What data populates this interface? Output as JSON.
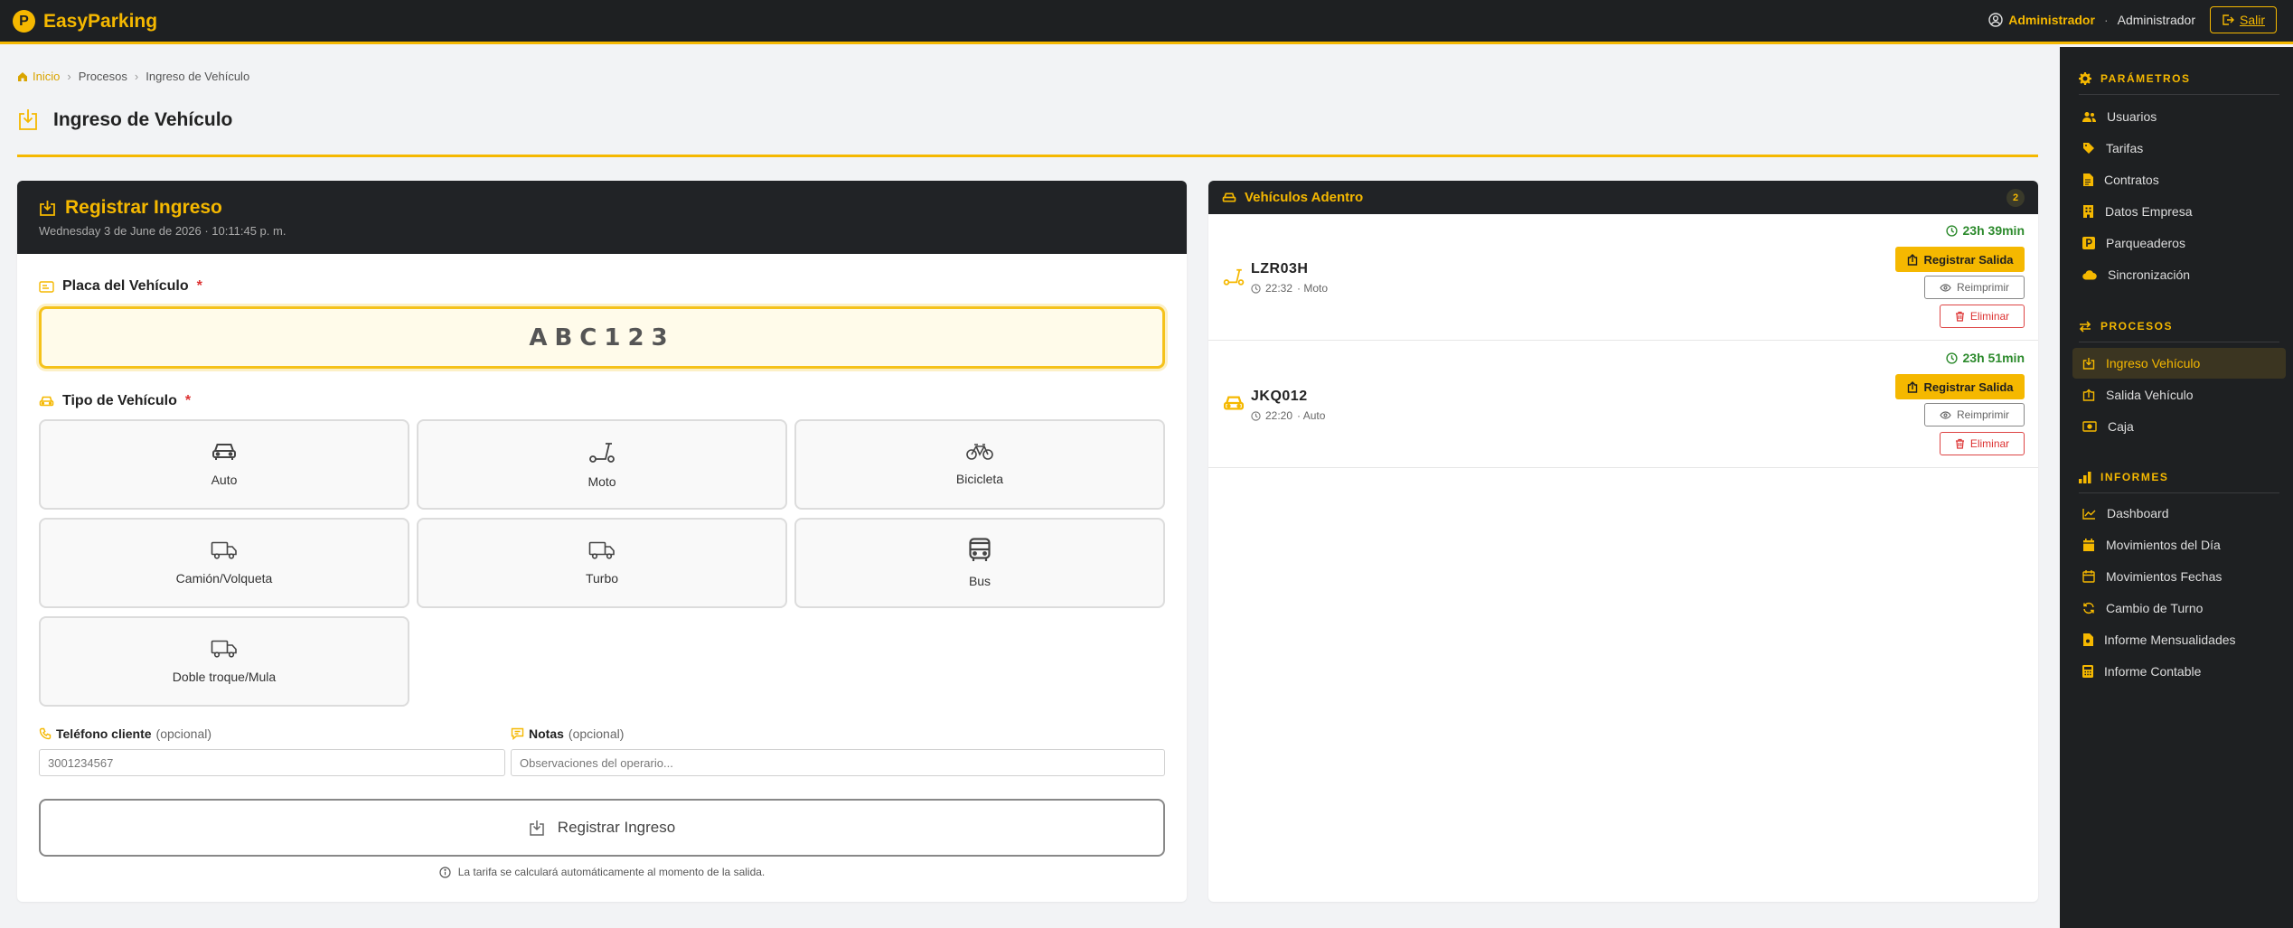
{
  "app": {
    "name": "EasyParking",
    "badge": "P"
  },
  "header": {
    "user_name": "Administrador",
    "separator": "·",
    "user_role": "Administrador",
    "logout_label": "Salir"
  },
  "breadcrumb": {
    "home": "Inicio",
    "sep": "›",
    "items": [
      "Procesos",
      "Ingreso de Vehículo"
    ]
  },
  "page": {
    "title": "Ingreso de Vehículo"
  },
  "form": {
    "title": "Registrar Ingreso",
    "datetime": "Wednesday 3 de June de 2026  ·  10:11:45 p. m.",
    "plate_label": "Placa del Vehículo",
    "required_mark": "*",
    "plate_value": "ABC123",
    "type_label": "Tipo de Vehículo",
    "vehicle_types": [
      {
        "label": "Auto",
        "icon": "car-icon"
      },
      {
        "label": "Moto",
        "icon": "scooter-icon"
      },
      {
        "label": "Bicicleta",
        "icon": "bicycle-icon"
      },
      {
        "label": "Camión/Volqueta",
        "icon": "truck-icon"
      },
      {
        "label": "Turbo",
        "icon": "truck-icon"
      },
      {
        "label": "Bus",
        "icon": "bus-icon"
      },
      {
        "label": "Doble troque/Mula",
        "icon": "truck-icon"
      }
    ],
    "phone_label": "Teléfono cliente",
    "phone_optional": "(opcional)",
    "phone_placeholder": "3001234567",
    "notes_label": "Notas",
    "notes_optional": "(opcional)",
    "notes_placeholder": "Observaciones del operario...",
    "submit_label": "Registrar Ingreso",
    "footnote": "La tarifa se calculará automáticamente al momento de la salida."
  },
  "inside": {
    "title": "Vehículos Adentro",
    "count": "2",
    "vehicles": [
      {
        "plate": "LZR03H",
        "time": "22:32",
        "type": "· Moto",
        "duration": "23h 39min",
        "icon": "scooter-icon"
      },
      {
        "plate": "JKQ012",
        "time": "22:20",
        "type": "· Auto",
        "duration": "23h 51min",
        "icon": "car-icon"
      }
    ],
    "exit_label": "Registrar Salida",
    "reprint_label": "Reimprimir",
    "delete_label": "Eliminar"
  },
  "sidebar": {
    "sections": [
      {
        "title": "PARÁMETROS",
        "items": [
          "Usuarios",
          "Tarifas",
          "Contratos",
          "Datos Empresa",
          "Parqueaderos",
          "Sincronización"
        ]
      },
      {
        "title": "PROCESOS",
        "items": [
          "Ingreso Vehículo",
          "Salida Vehículo",
          "Caja"
        ]
      },
      {
        "title": "INFORMES",
        "items": [
          "Dashboard",
          "Movimientos del Día",
          "Movimientos Fechas",
          "Cambio de Turno",
          "Informe Mensualidades",
          "Informe Contable"
        ]
      }
    ],
    "active_item": "Ingreso Vehículo"
  },
  "colors": {
    "accent": "#f5b800",
    "dark": "#1e2022",
    "success": "#2c8a2c",
    "danger": "#d33333"
  }
}
